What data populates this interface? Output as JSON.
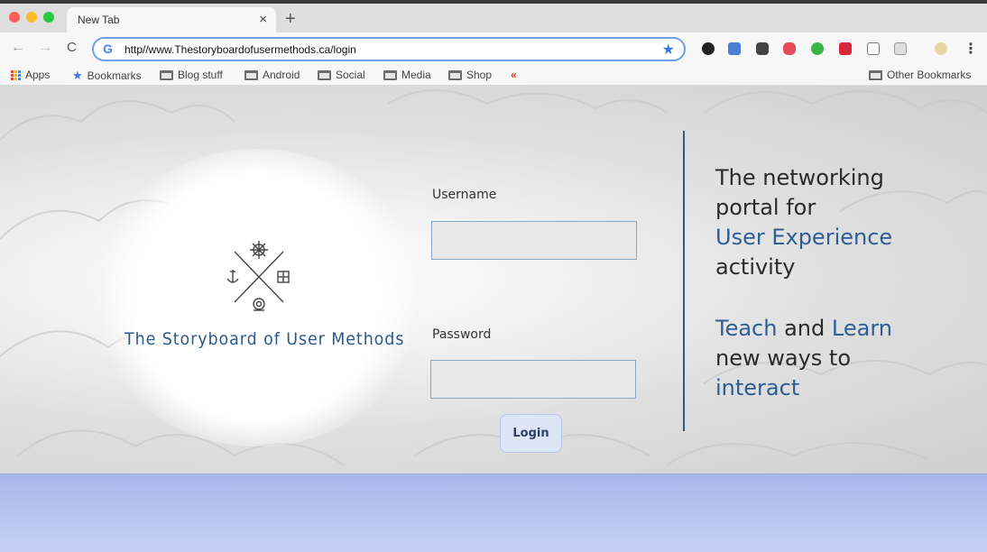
{
  "browser": {
    "tab_title": "New Tab",
    "tab_close": "×",
    "new_tab": "+",
    "nav": {
      "back": "←",
      "forward": "→",
      "reload": "C"
    },
    "url": "http//www.Thestoryboardofusermethods.ca/login",
    "menu": "⋮",
    "bookmarks": [
      "Apps",
      "Bookmarks",
      "Blog stuff",
      "Android",
      "Social",
      "Media",
      "Shop"
    ],
    "other_bookmarks": "Other Bookmarks"
  },
  "page": {
    "brand_name": "The Storyboard of User Methods",
    "form": {
      "username_label": "Username",
      "username_value": "",
      "password_label": "Password",
      "password_value": "",
      "login_label": "Login"
    },
    "tagline": {
      "line1": "The networking",
      "line2": "portal for",
      "line3": "User Experience",
      "line4": "activity",
      "teach": "Teach",
      "and": " and ",
      "learn": "Learn",
      "line6": "new ways to",
      "line7": "interact"
    }
  },
  "colors": {
    "accent_blue": "#2f5d95",
    "divider": "#2a5a8c",
    "footer": "#b4c2ef"
  }
}
